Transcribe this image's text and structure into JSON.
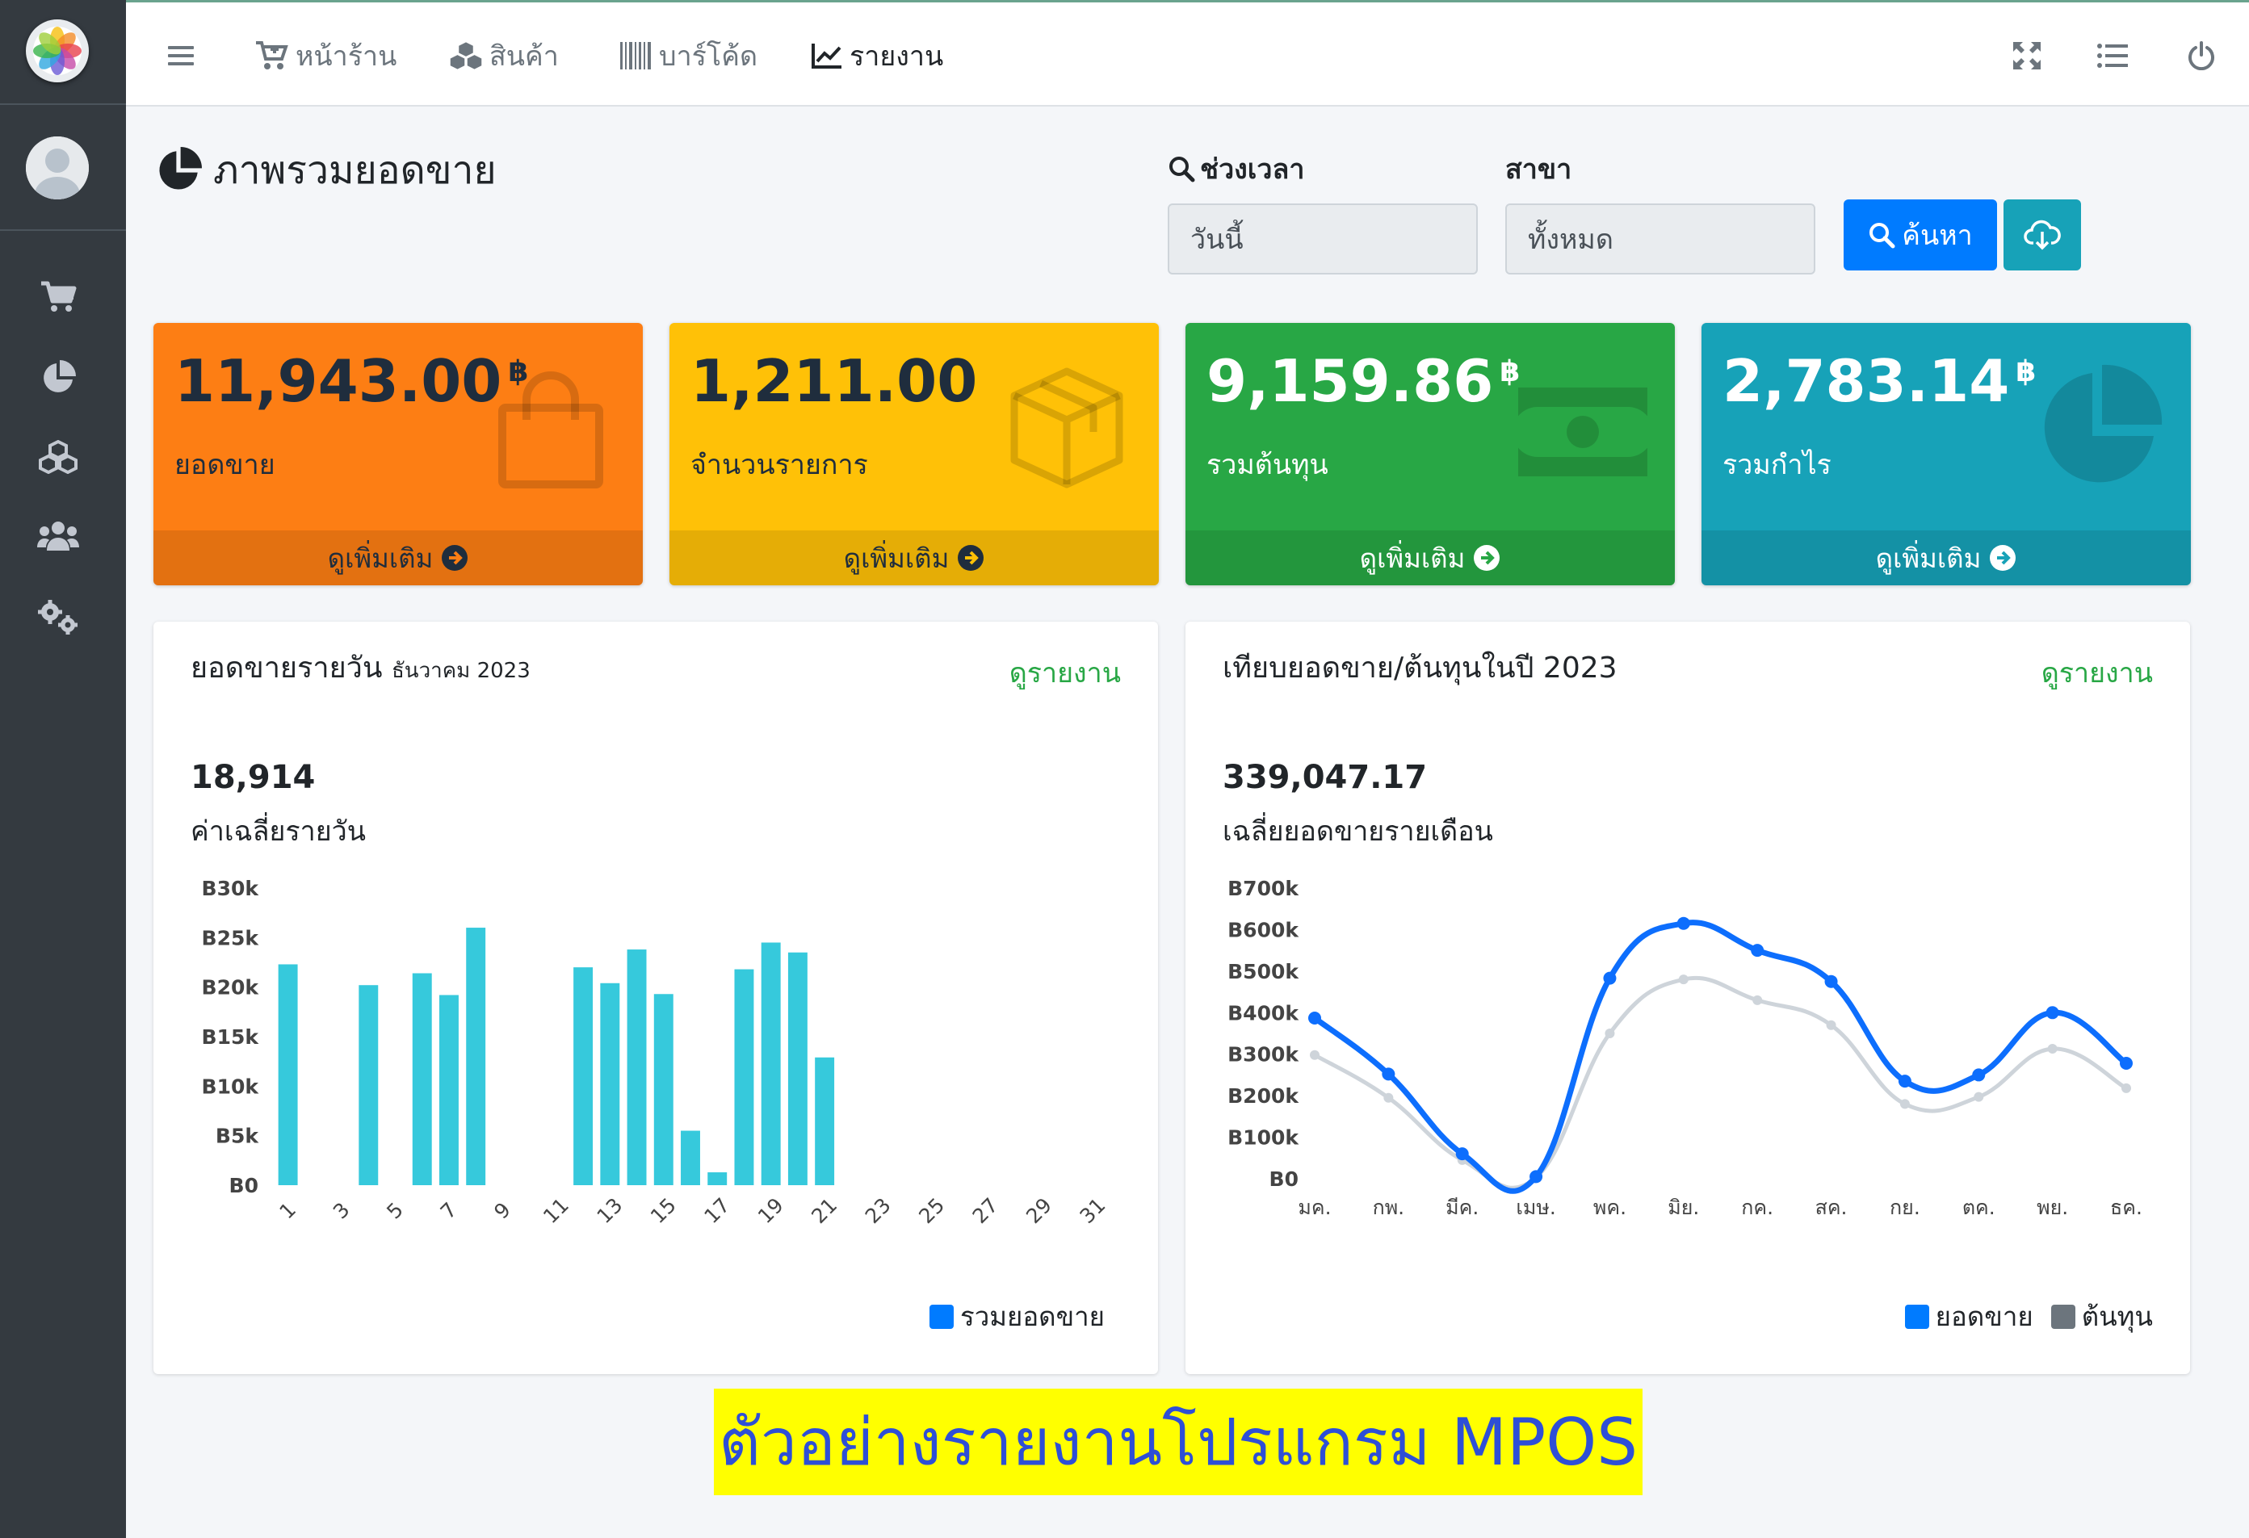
{
  "nav": {
    "items": [
      {
        "label": "หน้าร้าน",
        "icon": "cart-plus-icon"
      },
      {
        "label": "สินค้า",
        "icon": "cubes-icon"
      },
      {
        "label": "บาร์โค้ด",
        "icon": "barcode-icon"
      },
      {
        "label": "รายงาน",
        "icon": "line-chart-icon"
      }
    ],
    "right_icons": [
      "fullscreen-icon",
      "list-icon",
      "power-icon"
    ]
  },
  "sidebar": {
    "icons": [
      "cart-icon",
      "pie-chart-icon",
      "cubes-icon",
      "users-icon",
      "cogs-icon"
    ]
  },
  "header": {
    "title": "ภาพรวมยอดขาย",
    "period_label": "ช่วงเวลา",
    "period_value": "วันนี้",
    "branch_label": "สาขา",
    "branch_value": "ทั้งหมด",
    "search_label": "ค้นหา"
  },
  "boxes": [
    {
      "value": "11,943.00",
      "currency": "฿",
      "label": "ยอดขาย",
      "more": "ดูเพิ่มเติม",
      "color": "#fd7e14",
      "text_color": "#1f2d3d",
      "icon": "shopping-bag-icon"
    },
    {
      "value": "1,211.00",
      "currency": "",
      "label": "จำนวนรายการ",
      "more": "ดูเพิ่มเติม",
      "color": "#ffc107",
      "text_color": "#1f2d3d",
      "icon": "box-icon"
    },
    {
      "value": "9,159.86",
      "currency": "฿",
      "label": "รวมต้นทุน",
      "more": "ดูเพิ่มเติม",
      "color": "#28a745",
      "text_color": "#ffffff",
      "icon": "money-icon"
    },
    {
      "value": "2,783.14",
      "currency": "฿",
      "label": "รวมกำไร",
      "more": "ดูเพิ่มเติม",
      "color": "#17a2b8",
      "text_color": "#ffffff",
      "icon": "pie-chart-icon"
    }
  ],
  "daily_card": {
    "title": "ยอดขายรายวัน",
    "subtitle": "ธันวาคม 2023",
    "link": "ดูรายงาน",
    "big_value": "18,914",
    "big_label": "ค่าเฉลี่ยรายวัน",
    "legend": "รวมยอดขาย"
  },
  "monthly_card": {
    "title": "เทียบยอดขาย/ต้นทุนในปี 2023",
    "link": "ดูรายงาน",
    "big_value": "339,047.17",
    "big_label": "เฉลี่ยยอดขายรายเดือน",
    "legend_sales": "ยอดขาย",
    "legend_cost": "ต้นทุน"
  },
  "chart_data": [
    {
      "type": "bar",
      "title": "ยอดขายรายวัน",
      "categories": [
        "1",
        "2",
        "3",
        "4",
        "5",
        "6",
        "7",
        "8",
        "9",
        "10",
        "11",
        "12",
        "13",
        "14",
        "15",
        "16",
        "17",
        "18",
        "19",
        "20",
        "21",
        "22",
        "23",
        "24",
        "25",
        "26",
        "27",
        "28",
        "29",
        "30",
        "31"
      ],
      "x_tick_labels": [
        "1",
        "3",
        "5",
        "7",
        "9",
        "11",
        "13",
        "15",
        "17",
        "19",
        "21",
        "23",
        "25",
        "27",
        "29",
        "31"
      ],
      "y_tick_labels": [
        "B0",
        "B5k",
        "B10k",
        "B15k",
        "B20k",
        "B25k",
        "B30k"
      ],
      "ylim": [
        0,
        30000
      ],
      "series": [
        {
          "name": "รวมยอดขาย",
          "color": "#36c9dc",
          "values": [
            22300,
            0,
            0,
            20200,
            0,
            21400,
            19200,
            26000,
            0,
            0,
            0,
            22000,
            20400,
            23800,
            19300,
            5500,
            1300,
            21800,
            24500,
            23500,
            12900,
            0,
            0,
            0,
            0,
            0,
            0,
            0,
            0,
            0,
            0
          ]
        }
      ],
      "legend": "bottom-right",
      "grid": false
    },
    {
      "type": "line",
      "title": "เทียบยอดขาย/ต้นทุนในปี 2023",
      "categories": [
        "มค.",
        "กพ.",
        "มีค.",
        "เมษ.",
        "พค.",
        "มิย.",
        "กค.",
        "สค.",
        "กย.",
        "ตค.",
        "พย.",
        "ธค."
      ],
      "y_tick_labels": [
        "B0",
        "B100k",
        "B200k",
        "B300k",
        "B400k",
        "B500k",
        "B600k",
        "B700k"
      ],
      "ylim": [
        0,
        700000
      ],
      "series": [
        {
          "name": "ยอดขาย",
          "color": "#0d6efd",
          "values": [
            387000,
            252000,
            60000,
            5000,
            483000,
            615000,
            550000,
            475000,
            235000,
            250000,
            400000,
            278000
          ]
        },
        {
          "name": "ต้นทุน",
          "color": "#ced4da",
          "values": [
            298000,
            195000,
            45000,
            3000,
            350000,
            480000,
            430000,
            370000,
            180000,
            197000,
            313000,
            218000
          ]
        }
      ],
      "legend": "bottom-right",
      "grid": false
    }
  ],
  "banner": "ตัวอย่างรายงานโปรแกรม MPOS"
}
